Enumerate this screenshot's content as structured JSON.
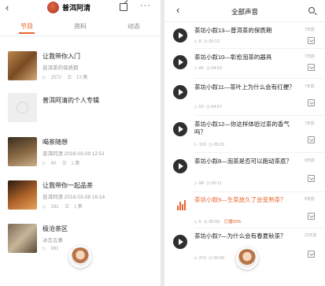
{
  "left": {
    "header": {
      "back": "‹",
      "title": "普洱阿清",
      "more": "···"
    },
    "tabs": [
      {
        "label": "节目",
        "active": true
      },
      {
        "label": "资料",
        "active": false
      },
      {
        "label": "动态",
        "active": false
      }
    ],
    "albums": [
      {
        "title": "让我带你入门",
        "subtitle": "普洱茶的保质期",
        "plays": "2572",
        "episodes": "13 集"
      },
      {
        "title": "普洱阿清的个人专辑",
        "subtitle": "",
        "plays": "",
        "episodes": ""
      },
      {
        "title": "喝茶随想",
        "subtitle": "普洱阿清  2018-03-09 12:51",
        "plays": "40",
        "episodes": "1 集"
      },
      {
        "title": "让我带你一起品茶",
        "subtitle": "普洱阿清  2018-03-08 16:14",
        "plays": "262",
        "episodes": "1 集"
      },
      {
        "title": "极沧茶区",
        "subtitle": "冰岛五寨",
        "plays": "861",
        "episodes": ""
      }
    ]
  },
  "right": {
    "header": {
      "back": "‹",
      "title": "全部声音"
    },
    "tracks": [
      {
        "title": "茶坊小叙13—普洱茶的保质期",
        "plays": "8",
        "duration": "05:13",
        "played": "",
        "date": "7天前"
      },
      {
        "title": "茶坊小叙10—彰愈泡茶的器具",
        "plays": "85",
        "duration": "04:53",
        "played": "",
        "date": "7天前"
      },
      {
        "title": "茶坊小叙11—茶叶上为什么会有红梗？",
        "plays": "50",
        "duration": "04:57",
        "played": "",
        "date": "7天前"
      },
      {
        "title": "茶坊小叙12—你这样体验过茶的香气吗？",
        "plays": "103",
        "duration": "05:03",
        "played": "",
        "date": "7天前"
      },
      {
        "title": "茶坊小叙8—泡茶是否可以跑动茶底？",
        "plays": "98",
        "duration": "05:11",
        "played": "",
        "date": "8天前"
      },
      {
        "title": "茶坊小叙9—生茶放久了会变熟茶？",
        "plays": "6",
        "duration": "05:00",
        "played": "已播50%",
        "date": "8天前"
      },
      {
        "title": "茶坊小叙7—为什么会有春夏秋茶？",
        "plays": "373",
        "duration": "06:50",
        "played": "",
        "date": "22天前"
      }
    ]
  },
  "colors": {
    "accent": "#e8652e",
    "play_button": "#2f2f2f",
    "muted_text": "#999999"
  },
  "icons": [
    "back-icon",
    "share-icon",
    "more-icon",
    "search-icon",
    "play-icon",
    "download-icon",
    "audio-bars-icon"
  ]
}
